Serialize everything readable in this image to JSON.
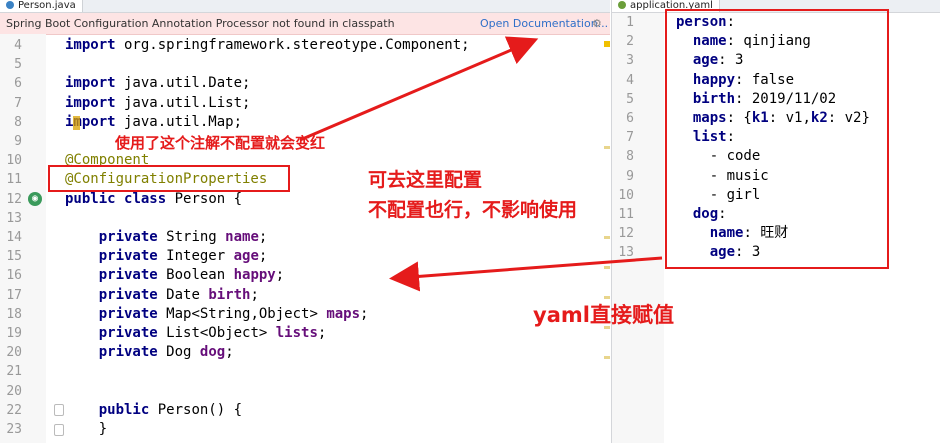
{
  "left_tab": {
    "label": "Person.java"
  },
  "right_tab": {
    "label": "application.yaml"
  },
  "banner": {
    "message": "Spring Boot Configuration Annotation Processor not found in classpath",
    "link": "Open Documentation..."
  },
  "java_lines": [
    {
      "n": "4",
      "code": "import org.springframework.stereotype.Component;"
    },
    {
      "n": "5",
      "code": ""
    },
    {
      "n": "6",
      "code": "import java.util.Date;"
    },
    {
      "n": "7",
      "code": "import java.util.List;"
    },
    {
      "n": "8",
      "code": "import java.util.Map;"
    },
    {
      "n": "9",
      "code": ""
    },
    {
      "n": "10",
      "code": "@Component"
    },
    {
      "n": "11",
      "code": "@ConfigurationProperties"
    },
    {
      "n": "12",
      "code": "public class Person {"
    },
    {
      "n": "13",
      "code": ""
    },
    {
      "n": "14",
      "code": "    private String name;"
    },
    {
      "n": "15",
      "code": "    private Integer age;"
    },
    {
      "n": "16",
      "code": "    private Boolean happy;"
    },
    {
      "n": "17",
      "code": "    private Date birth;"
    },
    {
      "n": "18",
      "code": "    private Map<String,Object> maps;"
    },
    {
      "n": "19",
      "code": "    private List<Object> lists;"
    },
    {
      "n": "20",
      "code": "    private Dog dog;"
    },
    {
      "n": "21",
      "code": ""
    },
    {
      "n": "20",
      "code": ""
    },
    {
      "n": "22",
      "code": "    public Person() {"
    },
    {
      "n": "23",
      "code": "    }"
    }
  ],
  "yaml_lines": [
    {
      "n": "1",
      "code": "person:"
    },
    {
      "n": "2",
      "code": "  name: qinjiang"
    },
    {
      "n": "3",
      "code": "  age: 3"
    },
    {
      "n": "4",
      "code": "  happy: false"
    },
    {
      "n": "5",
      "code": "  birth: 2019/11/02"
    },
    {
      "n": "6",
      "code": "  maps: {k1: v1,k2: v2}"
    },
    {
      "n": "7",
      "code": "  list:"
    },
    {
      "n": "8",
      "code": "    - code"
    },
    {
      "n": "9",
      "code": "    - music"
    },
    {
      "n": "10",
      "code": "    - girl"
    },
    {
      "n": "11",
      "code": "  dog:"
    },
    {
      "n": "12",
      "code": "    name: 旺财"
    },
    {
      "n": "13",
      "code": "    age: 3"
    }
  ],
  "annotations": {
    "red_note": "使用了这个注解不配置就会变红",
    "config_note_1": "可去这里配置",
    "config_note_2": "不配置也行，不影响使用",
    "yaml_note": "yaml直接赋值"
  },
  "colors": {
    "accent_red": "#e51b1b",
    "keyword": "#000080",
    "field": "#660e7a",
    "annotation": "#808000"
  }
}
